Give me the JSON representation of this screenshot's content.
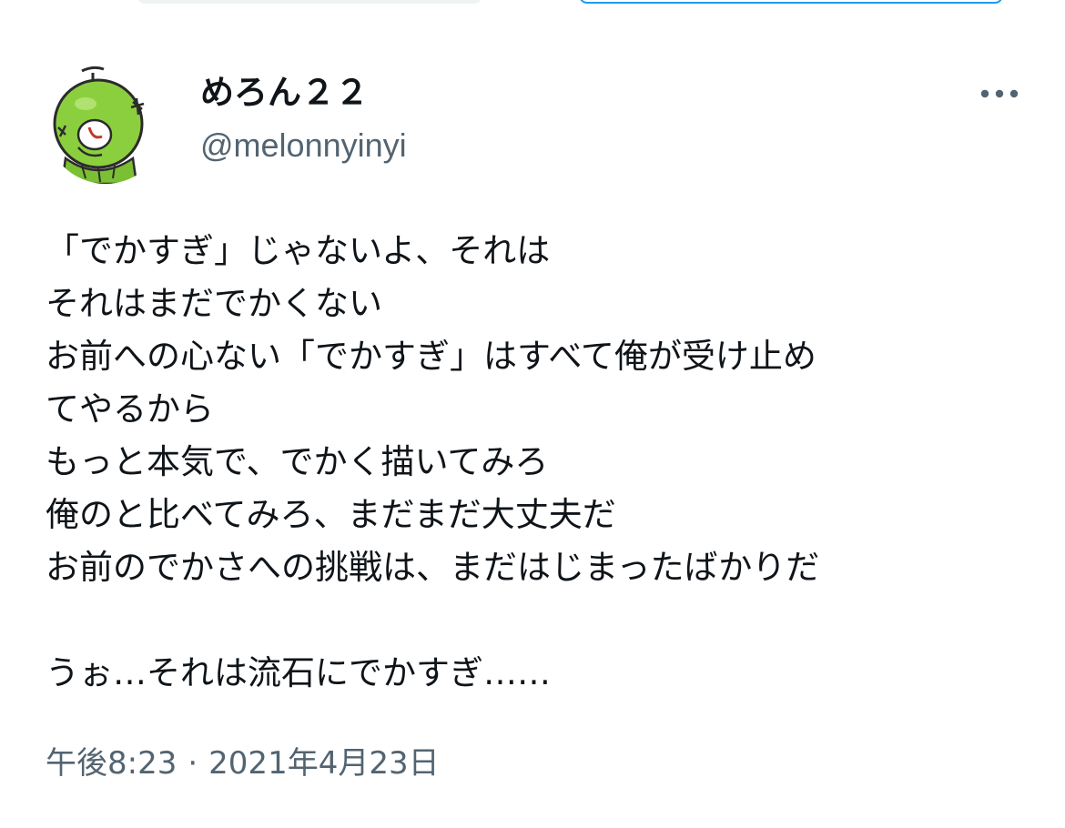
{
  "author": {
    "display_name": "めろん２２",
    "handle": "@melonnyinyi",
    "avatar_icon": "melon-character-avatar"
  },
  "more_icon": "more-horizontal-icon",
  "tweet": {
    "lines": [
      "「でかすぎ」じゃないよ、それは",
      "それはまだでかくない",
      "お前への心ない「でかすぎ」はすべて俺が受け止め",
      "てやるから",
      "もっと本気で、でかく描いてみろ",
      "俺のと比べてみろ、まだまだ大丈夫だ",
      "お前のでかさへの挑戦は、まだはじまったばかりだ",
      "",
      "うぉ…それは流石にでかすぎ……"
    ]
  },
  "meta": {
    "time": "午後8:23",
    "separator": "·",
    "date": "2021年4月23日"
  },
  "colors": {
    "text_primary": "#0f1419",
    "text_secondary": "#536471",
    "accent": "#1d9bf0",
    "avatar_green": "#8ccf3e"
  }
}
